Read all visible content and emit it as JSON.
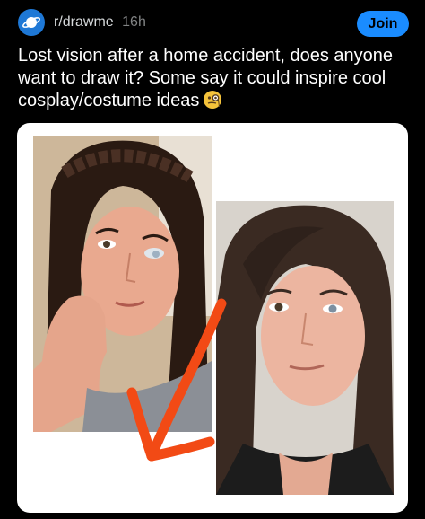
{
  "post": {
    "subreddit": "r/drawme",
    "age": "16h",
    "join_label": "Join",
    "title": "Lost vision after a home accident, does anyone want to draw it? Some say it could inspire cool cosplay/costume ideas",
    "emoji": "monocle-face-emoji"
  },
  "icons": {
    "subreddit_avatar": "planet-icon",
    "arrow": "red-arrow-annotation"
  },
  "images": {
    "left": "photo-of-woman-with-braided-hair-before",
    "right": "photo-of-woman-with-bangs-after"
  },
  "colors": {
    "background": "#000000",
    "join_button": "#1a8cff",
    "avatar": "#1e78d6",
    "arrow": "#f24a15",
    "card": "#ffffff"
  }
}
